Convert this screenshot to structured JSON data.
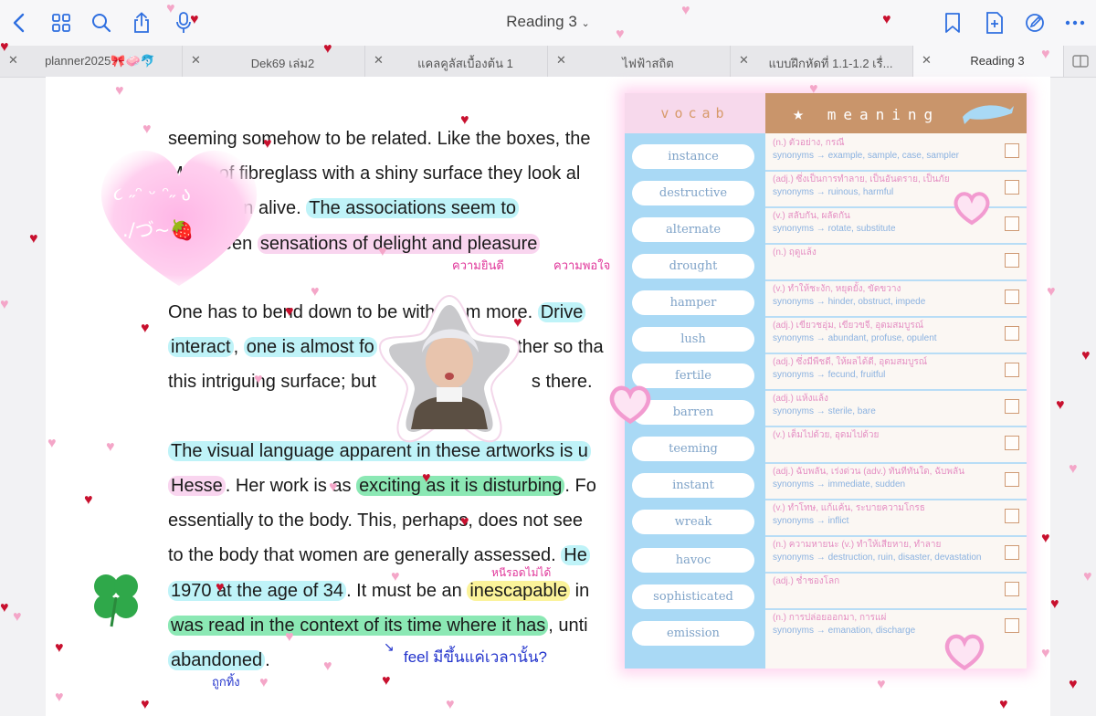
{
  "toolbar": {
    "title": "Reading 3",
    "icons": [
      "chevron-left-icon",
      "grid-icon",
      "search-icon",
      "share-icon",
      "microphone-icon",
      "bookmark-icon",
      "add-page-icon",
      "pen-circle-icon",
      "more-icon"
    ]
  },
  "tabs": [
    {
      "label": "planner2025🎀🧼🐬",
      "active": false
    },
    {
      "label": "Dek69 เล่ม2",
      "active": false
    },
    {
      "label": "แคลคูลัสเบื้องต้น 1",
      "active": false
    },
    {
      "label": "ไฟฟ้าสถิต",
      "active": false
    },
    {
      "label": "แบบฝึกหัดที่ 1.1-1.2 เรื่...",
      "active": false
    },
    {
      "label": "Reading 3",
      "active": true
    }
  ],
  "document": {
    "l1a": "seeming somehow to be related. Like the boxes, the",
    "l2a": "Made of fibreglass with a shiny surface they look al",
    "l3a": "once been alive. ",
    "l3b": "The associations seem to",
    "l4a": "g between ",
    "l4b": "sensations of delight and pleasure",
    "l5a": "One has to bend down to be with them more. ",
    "l5b": "Drive",
    "l6a": "interact",
    "l6b": ", ",
    "l6c": "one is almost fo",
    "l6d": "further so tha",
    "l7a": "this intriguing surface; but",
    "l7b": "s there.",
    "l8a": "The visual language apparent in these artworks is u",
    "l9a": "Hesse",
    "l9b": ". Her work is as ",
    "l9c": "exciting as it is disturbing",
    "l9d": ". Fo",
    "l10a": "essentially to the body. This, perhaps, does not see",
    "l11a": "to the body that women are generally assessed. ",
    "l11b": "He",
    "l12a": "1970 at the age of 34",
    "l12b": ". It must be an ",
    "l12c": "inescapable",
    "l12d": " in",
    "l13a": "was read in the context of its time where it has",
    "l13b": ", unti",
    "l14a": "abandoned",
    "l14b": "."
  },
  "annotations": {
    "delight": "ความยินดี",
    "pleasure": "ความพอใจ",
    "inescapable": "หนีรอดไม่ได้",
    "feel": "feel มีขึ้นแค่เวลานั้น?",
    "abandoned": "ถูกทิ้ง",
    "arrow": "↘"
  },
  "sticker": {
    "kaomoji_1": "૮ ˶ᵔ ᵕ ᵔ˶ ა",
    "kaomoji_2": "./づ~🍓"
  },
  "vocab": {
    "header_left": "vocab",
    "header_right": "meaning",
    "rows": [
      {
        "word": "instance",
        "pos": "(n.) ตัวอย่าง, กรณี",
        "syn": "synonyms → example, sample, case, sampler"
      },
      {
        "word": "destructive",
        "pos": "(adj.) ซึ่งเป็นการทำลาย, เป็นอันตราย, เป็นภัย",
        "syn": "synonyms → ruinous, harmful"
      },
      {
        "word": "alternate",
        "pos": "(v.) สลับกัน, ผลัดกัน",
        "syn": "synonyms → rotate, substitute"
      },
      {
        "word": "drought",
        "pos": "(n.) ฤดูแล้ง",
        "syn": ""
      },
      {
        "word": "hamper",
        "pos": "(v.) ทำให้ชะงัก, หยุดยั้ง, ขัดขวาง",
        "syn": "synonyms → hinder, obstruct, impede"
      },
      {
        "word": "lush",
        "pos": "(adj.) เขียวชอุ่ม, เขียวขจี, อุดมสมบูรณ์",
        "syn": "synonyms → abundant, profuse, opulent"
      },
      {
        "word": "fertile",
        "pos": "(adj.) ซึ่งมีพืชดี, ให้ผลได้ดี, อุดมสมบูรณ์",
        "syn": "synonyms → fecund, fruitful"
      },
      {
        "word": "barren",
        "pos": "(adj.) แห้งแล้ง",
        "syn": "synonyms → sterile, bare"
      },
      {
        "word": "teeming",
        "pos": "(v.) เต็มไปด้วย, อุดมไปด้วย",
        "syn": ""
      },
      {
        "word": "instant",
        "pos": "(adj.) ฉับพลัน, เร่งด่วน (adv.) ทันทีทันใด, ฉับพลัน",
        "syn": "synonyms → immediate, sudden"
      },
      {
        "word": "wreak",
        "pos": "(v.) ทำโทษ, แก้แค้น, ระบายความโกรธ",
        "syn": "synonyms → inflict"
      },
      {
        "word": "havoc",
        "pos": "(n.) ความหายนะ (v.) ทำให้เสียหาย, ทำลาย",
        "syn": "synonyms → destruction, ruin, disaster, devastation"
      },
      {
        "word": "sophisticated",
        "pos": "(adj.) ช่ำชองโลก",
        "syn": ""
      },
      {
        "word": "emission",
        "pos": "(n.) การปล่อยออกมา, การแผ่",
        "syn": "synonyms → emanation, discharge"
      }
    ]
  },
  "colors": {
    "accent": "#2f6fe0",
    "highlight_blue": "#bff3f8",
    "highlight_pink": "#f9d5ef",
    "highlight_green": "#8be8b4",
    "highlight_yellow": "#fbf39a",
    "note_pink": "#e0369a",
    "note_blue": "#2233cc"
  }
}
